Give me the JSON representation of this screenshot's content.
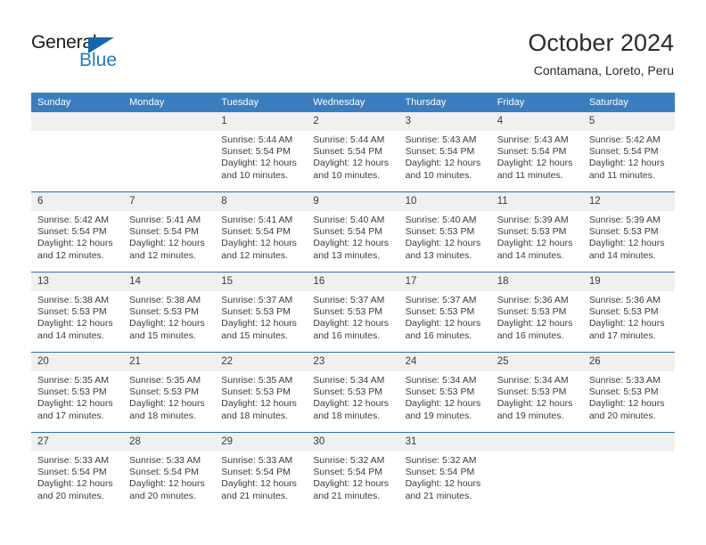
{
  "logo": {
    "word_one": "General",
    "word_two": "Blue",
    "triangle_color": "#1565b0",
    "blue_color": "#1f7ac4"
  },
  "header": {
    "title": "October 2024",
    "subtitle": "Contamana, Loreto, Peru"
  },
  "theme": {
    "header_row_bg": "#3a7ebf",
    "row_divider": "#2e6da4",
    "daynum_bg": "#f0f0f0"
  },
  "calendar": {
    "weekday_headers": [
      "Sunday",
      "Monday",
      "Tuesday",
      "Wednesday",
      "Thursday",
      "Friday",
      "Saturday"
    ],
    "weeks": [
      [
        {
          "day": "",
          "sunrise": "",
          "sunset": "",
          "daylight_line1": "",
          "daylight_line2": ""
        },
        {
          "day": "",
          "sunrise": "",
          "sunset": "",
          "daylight_line1": "",
          "daylight_line2": ""
        },
        {
          "day": "1",
          "sunrise": "Sunrise: 5:44 AM",
          "sunset": "Sunset: 5:54 PM",
          "daylight_line1": "Daylight: 12 hours",
          "daylight_line2": "and 10 minutes."
        },
        {
          "day": "2",
          "sunrise": "Sunrise: 5:44 AM",
          "sunset": "Sunset: 5:54 PM",
          "daylight_line1": "Daylight: 12 hours",
          "daylight_line2": "and 10 minutes."
        },
        {
          "day": "3",
          "sunrise": "Sunrise: 5:43 AM",
          "sunset": "Sunset: 5:54 PM",
          "daylight_line1": "Daylight: 12 hours",
          "daylight_line2": "and 10 minutes."
        },
        {
          "day": "4",
          "sunrise": "Sunrise: 5:43 AM",
          "sunset": "Sunset: 5:54 PM",
          "daylight_line1": "Daylight: 12 hours",
          "daylight_line2": "and 11 minutes."
        },
        {
          "day": "5",
          "sunrise": "Sunrise: 5:42 AM",
          "sunset": "Sunset: 5:54 PM",
          "daylight_line1": "Daylight: 12 hours",
          "daylight_line2": "and 11 minutes."
        }
      ],
      [
        {
          "day": "6",
          "sunrise": "Sunrise: 5:42 AM",
          "sunset": "Sunset: 5:54 PM",
          "daylight_line1": "Daylight: 12 hours",
          "daylight_line2": "and 12 minutes."
        },
        {
          "day": "7",
          "sunrise": "Sunrise: 5:41 AM",
          "sunset": "Sunset: 5:54 PM",
          "daylight_line1": "Daylight: 12 hours",
          "daylight_line2": "and 12 minutes."
        },
        {
          "day": "8",
          "sunrise": "Sunrise: 5:41 AM",
          "sunset": "Sunset: 5:54 PM",
          "daylight_line1": "Daylight: 12 hours",
          "daylight_line2": "and 12 minutes."
        },
        {
          "day": "9",
          "sunrise": "Sunrise: 5:40 AM",
          "sunset": "Sunset: 5:54 PM",
          "daylight_line1": "Daylight: 12 hours",
          "daylight_line2": "and 13 minutes."
        },
        {
          "day": "10",
          "sunrise": "Sunrise: 5:40 AM",
          "sunset": "Sunset: 5:53 PM",
          "daylight_line1": "Daylight: 12 hours",
          "daylight_line2": "and 13 minutes."
        },
        {
          "day": "11",
          "sunrise": "Sunrise: 5:39 AM",
          "sunset": "Sunset: 5:53 PM",
          "daylight_line1": "Daylight: 12 hours",
          "daylight_line2": "and 14 minutes."
        },
        {
          "day": "12",
          "sunrise": "Sunrise: 5:39 AM",
          "sunset": "Sunset: 5:53 PM",
          "daylight_line1": "Daylight: 12 hours",
          "daylight_line2": "and 14 minutes."
        }
      ],
      [
        {
          "day": "13",
          "sunrise": "Sunrise: 5:38 AM",
          "sunset": "Sunset: 5:53 PM",
          "daylight_line1": "Daylight: 12 hours",
          "daylight_line2": "and 14 minutes."
        },
        {
          "day": "14",
          "sunrise": "Sunrise: 5:38 AM",
          "sunset": "Sunset: 5:53 PM",
          "daylight_line1": "Daylight: 12 hours",
          "daylight_line2": "and 15 minutes."
        },
        {
          "day": "15",
          "sunrise": "Sunrise: 5:37 AM",
          "sunset": "Sunset: 5:53 PM",
          "daylight_line1": "Daylight: 12 hours",
          "daylight_line2": "and 15 minutes."
        },
        {
          "day": "16",
          "sunrise": "Sunrise: 5:37 AM",
          "sunset": "Sunset: 5:53 PM",
          "daylight_line1": "Daylight: 12 hours",
          "daylight_line2": "and 16 minutes."
        },
        {
          "day": "17",
          "sunrise": "Sunrise: 5:37 AM",
          "sunset": "Sunset: 5:53 PM",
          "daylight_line1": "Daylight: 12 hours",
          "daylight_line2": "and 16 minutes."
        },
        {
          "day": "18",
          "sunrise": "Sunrise: 5:36 AM",
          "sunset": "Sunset: 5:53 PM",
          "daylight_line1": "Daylight: 12 hours",
          "daylight_line2": "and 16 minutes."
        },
        {
          "day": "19",
          "sunrise": "Sunrise: 5:36 AM",
          "sunset": "Sunset: 5:53 PM",
          "daylight_line1": "Daylight: 12 hours",
          "daylight_line2": "and 17 minutes."
        }
      ],
      [
        {
          "day": "20",
          "sunrise": "Sunrise: 5:35 AM",
          "sunset": "Sunset: 5:53 PM",
          "daylight_line1": "Daylight: 12 hours",
          "daylight_line2": "and 17 minutes."
        },
        {
          "day": "21",
          "sunrise": "Sunrise: 5:35 AM",
          "sunset": "Sunset: 5:53 PM",
          "daylight_line1": "Daylight: 12 hours",
          "daylight_line2": "and 18 minutes."
        },
        {
          "day": "22",
          "sunrise": "Sunrise: 5:35 AM",
          "sunset": "Sunset: 5:53 PM",
          "daylight_line1": "Daylight: 12 hours",
          "daylight_line2": "and 18 minutes."
        },
        {
          "day": "23",
          "sunrise": "Sunrise: 5:34 AM",
          "sunset": "Sunset: 5:53 PM",
          "daylight_line1": "Daylight: 12 hours",
          "daylight_line2": "and 18 minutes."
        },
        {
          "day": "24",
          "sunrise": "Sunrise: 5:34 AM",
          "sunset": "Sunset: 5:53 PM",
          "daylight_line1": "Daylight: 12 hours",
          "daylight_line2": "and 19 minutes."
        },
        {
          "day": "25",
          "sunrise": "Sunrise: 5:34 AM",
          "sunset": "Sunset: 5:53 PM",
          "daylight_line1": "Daylight: 12 hours",
          "daylight_line2": "and 19 minutes."
        },
        {
          "day": "26",
          "sunrise": "Sunrise: 5:33 AM",
          "sunset": "Sunset: 5:53 PM",
          "daylight_line1": "Daylight: 12 hours",
          "daylight_line2": "and 20 minutes."
        }
      ],
      [
        {
          "day": "27",
          "sunrise": "Sunrise: 5:33 AM",
          "sunset": "Sunset: 5:54 PM",
          "daylight_line1": "Daylight: 12 hours",
          "daylight_line2": "and 20 minutes."
        },
        {
          "day": "28",
          "sunrise": "Sunrise: 5:33 AM",
          "sunset": "Sunset: 5:54 PM",
          "daylight_line1": "Daylight: 12 hours",
          "daylight_line2": "and 20 minutes."
        },
        {
          "day": "29",
          "sunrise": "Sunrise: 5:33 AM",
          "sunset": "Sunset: 5:54 PM",
          "daylight_line1": "Daylight: 12 hours",
          "daylight_line2": "and 21 minutes."
        },
        {
          "day": "30",
          "sunrise": "Sunrise: 5:32 AM",
          "sunset": "Sunset: 5:54 PM",
          "daylight_line1": "Daylight: 12 hours",
          "daylight_line2": "and 21 minutes."
        },
        {
          "day": "31",
          "sunrise": "Sunrise: 5:32 AM",
          "sunset": "Sunset: 5:54 PM",
          "daylight_line1": "Daylight: 12 hours",
          "daylight_line2": "and 21 minutes."
        },
        {
          "day": "",
          "sunrise": "",
          "sunset": "",
          "daylight_line1": "",
          "daylight_line2": ""
        },
        {
          "day": "",
          "sunrise": "",
          "sunset": "",
          "daylight_line1": "",
          "daylight_line2": ""
        }
      ]
    ]
  }
}
